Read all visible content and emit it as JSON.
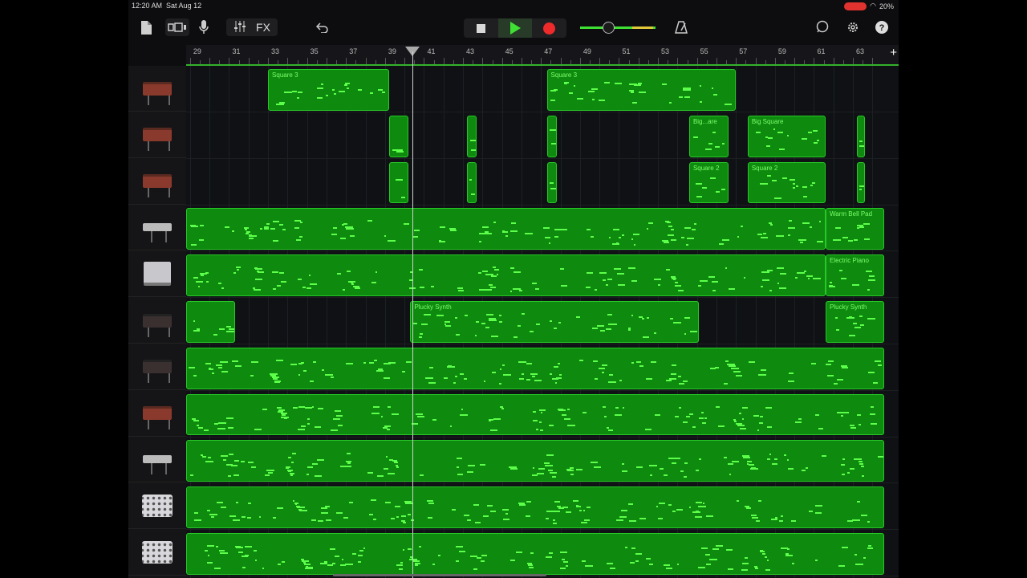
{
  "status": {
    "time": "12:20 AM",
    "date": "Sat Aug 12",
    "battery": "20%"
  },
  "toolbar": {
    "fx_label": "FX"
  },
  "ruler": {
    "bars": [
      "29",
      "31",
      "33",
      "35",
      "37",
      "39",
      "41",
      "43",
      "45",
      "47",
      "49",
      "51",
      "53",
      "55",
      "57",
      "59",
      "61",
      "63"
    ],
    "add_label": "+"
  },
  "tracks": [
    {
      "instrument": "synth-red",
      "regions": [
        {
          "name": "Square 3",
          "start": 33,
          "end": 39.2
        },
        {
          "name": "Square 3",
          "start": 47.3,
          "end": 57
        }
      ]
    },
    {
      "instrument": "synth-red",
      "regions": [
        {
          "name": "",
          "start": 39.2,
          "end": 40.2
        },
        {
          "name": "",
          "start": 43.2,
          "end": 43.7
        },
        {
          "name": "",
          "start": 47.3,
          "end": 47.8
        },
        {
          "name": "Big...are",
          "start": 54.6,
          "end": 56.6
        },
        {
          "name": "Big Square",
          "start": 57.6,
          "end": 61.6
        },
        {
          "name": "",
          "start": 63.2,
          "end": 63.6
        }
      ]
    },
    {
      "instrument": "synth-red",
      "regions": [
        {
          "name": "",
          "start": 39.2,
          "end": 40.2
        },
        {
          "name": "",
          "start": 43.2,
          "end": 43.7
        },
        {
          "name": "",
          "start": 47.3,
          "end": 47.8
        },
        {
          "name": "Square 2",
          "start": 54.6,
          "end": 56.6
        },
        {
          "name": "Square 2",
          "start": 57.6,
          "end": 61.6
        },
        {
          "name": "",
          "start": 63.2,
          "end": 63.6
        }
      ]
    },
    {
      "instrument": "keys",
      "regions": [
        {
          "name": "",
          "start": 28,
          "end": 61.6
        },
        {
          "name": "Warm Bell Pad",
          "start": 61.6,
          "end": 64.6
        }
      ]
    },
    {
      "instrument": "piano",
      "regions": [
        {
          "name": "",
          "start": 28,
          "end": 61.6
        },
        {
          "name": "Electric Piano",
          "start": 61.6,
          "end": 64.6
        }
      ]
    },
    {
      "instrument": "synth-dark",
      "regions": [
        {
          "name": "",
          "start": 28,
          "end": 31.3
        },
        {
          "name": "Plucky Synth",
          "start": 40.3,
          "end": 55.1
        },
        {
          "name": "Plucky Synth",
          "start": 61.6,
          "end": 64.6
        }
      ]
    },
    {
      "instrument": "synth-dark",
      "regions": [
        {
          "name": "",
          "start": 28,
          "end": 64.6
        }
      ]
    },
    {
      "instrument": "synth-red",
      "regions": [
        {
          "name": "",
          "start": 28,
          "end": 64.6
        }
      ]
    },
    {
      "instrument": "keys",
      "regions": [
        {
          "name": "",
          "start": 28,
          "end": 64.6
        }
      ]
    },
    {
      "instrument": "mpc",
      "regions": [
        {
          "name": "",
          "start": 28,
          "end": 64.6
        }
      ]
    },
    {
      "instrument": "mpc",
      "regions": [
        {
          "name": "",
          "start": 28,
          "end": 64.6
        }
      ]
    }
  ],
  "playhead_bar": 40.4,
  "colors": {
    "region_fill": "#0e8a0e",
    "note": "#5cff4a",
    "record": "#ee2a2a",
    "play": "#3ee033"
  },
  "icons": [
    "document-icon",
    "view-toggle-icon",
    "mic-icon",
    "mixer-icon",
    "undo-icon",
    "stop-icon",
    "play-icon",
    "record-icon",
    "metronome-icon",
    "loop-icon",
    "settings-icon",
    "help-icon"
  ]
}
